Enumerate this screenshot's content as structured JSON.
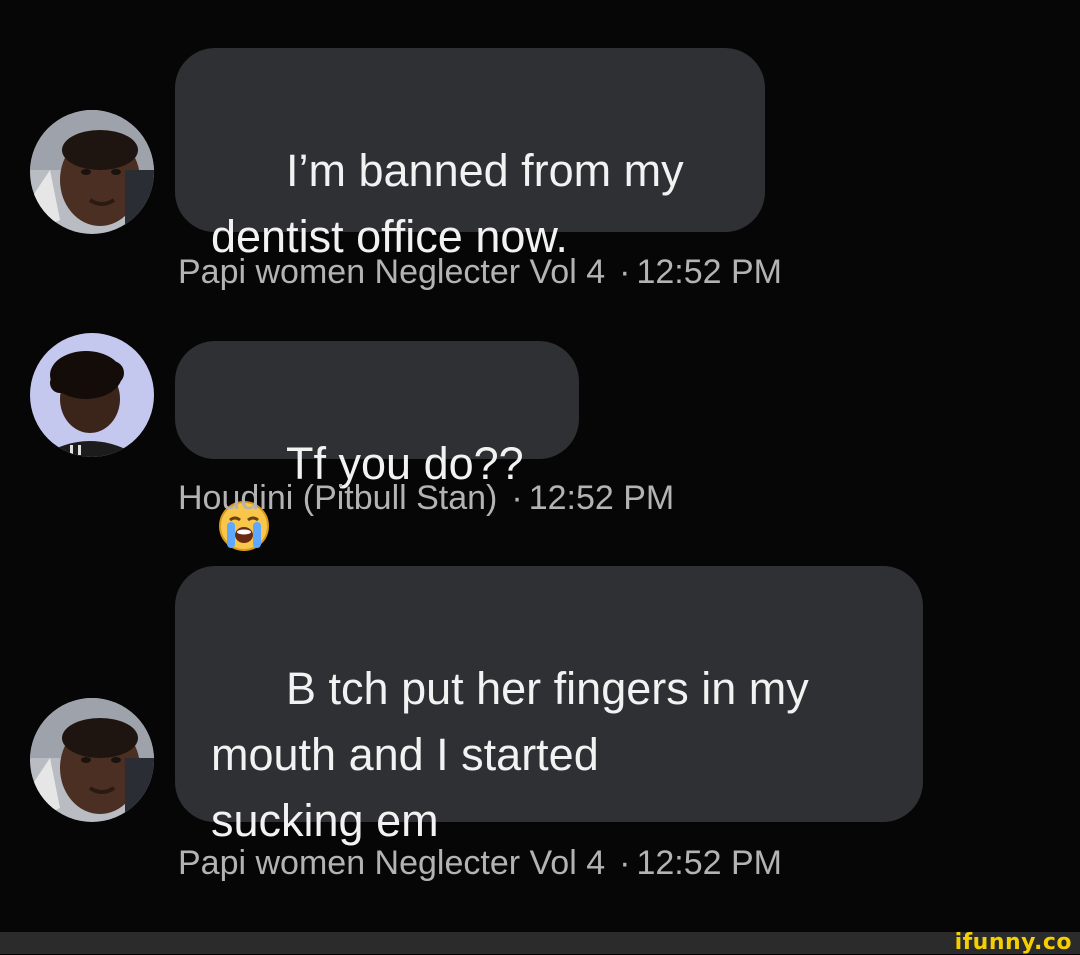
{
  "messages": [
    {
      "text": "I’m banned from my\ndentist office now.",
      "sender": "Papi women Neglecter Vol 4",
      "separator": "·",
      "time": "12:52 PM",
      "avatar_icon": "profile-photo-man-icon"
    },
    {
      "text": "Tf you do??",
      "emoji": "loudly-crying-face-icon",
      "sender": "Houdini (Pitbull Stan)",
      "separator": "·",
      "time": "12:52 PM",
      "avatar_icon": "profile-photo-curly-hair-icon"
    },
    {
      "text": "B tch put her fingers in my\nmouth and I started\nsucking em",
      "sender": "Papi women Neglecter Vol 4",
      "separator": "·",
      "time": "12:52 PM",
      "avatar_icon": "profile-photo-man-icon"
    }
  ],
  "watermark": "ifunny.co",
  "colors": {
    "background": "#060606",
    "bubble": "#2f3033",
    "bubble_text": "#f2f2f2",
    "meta_text": "#b3b3b3",
    "watermark": "#f5d000"
  }
}
